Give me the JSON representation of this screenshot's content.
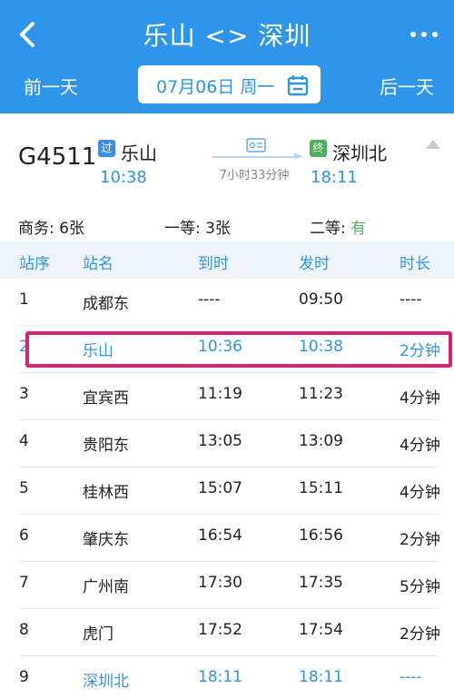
{
  "header": {
    "title": "乐山 <> 深圳",
    "prev_day": "前一天",
    "next_day": "后一天",
    "date": "07月06日 周一"
  },
  "train": {
    "number": "G4511",
    "from_badge": "过",
    "from_station": "乐山",
    "from_time": "10:38",
    "to_badge": "终",
    "to_station": "深圳北",
    "to_time": "18:11",
    "duration": "7小时33分钟"
  },
  "seats": {
    "business": {
      "label": "商务: ",
      "value": "6张"
    },
    "first": {
      "label": "一等: ",
      "value": "3张"
    },
    "second": {
      "label": "二等: ",
      "value": "有"
    }
  },
  "table": {
    "headers": [
      "站序",
      "站名",
      "到时",
      "发时",
      "时长"
    ],
    "rows": [
      [
        "1",
        "成都东",
        "----",
        "09:50",
        "----"
      ],
      [
        "2",
        "乐山",
        "10:36",
        "10:38",
        "2分钟"
      ],
      [
        "3",
        "宜宾西",
        "11:19",
        "11:23",
        "4分钟"
      ],
      [
        "4",
        "贵阳东",
        "13:05",
        "13:09",
        "4分钟"
      ],
      [
        "5",
        "桂林西",
        "15:07",
        "15:11",
        "4分钟"
      ],
      [
        "6",
        "肇庆东",
        "16:54",
        "16:56",
        "2分钟"
      ],
      [
        "7",
        "广州南",
        "17:30",
        "17:35",
        "5分钟"
      ],
      [
        "8",
        "虎门",
        "17:52",
        "17:54",
        "2分钟"
      ],
      [
        "9",
        "深圳北",
        "18:11",
        "18:11",
        "----"
      ]
    ]
  },
  "colors": {
    "primary": "#2f95ea",
    "highlight": "#d6246e",
    "available": "#4cb35a"
  }
}
